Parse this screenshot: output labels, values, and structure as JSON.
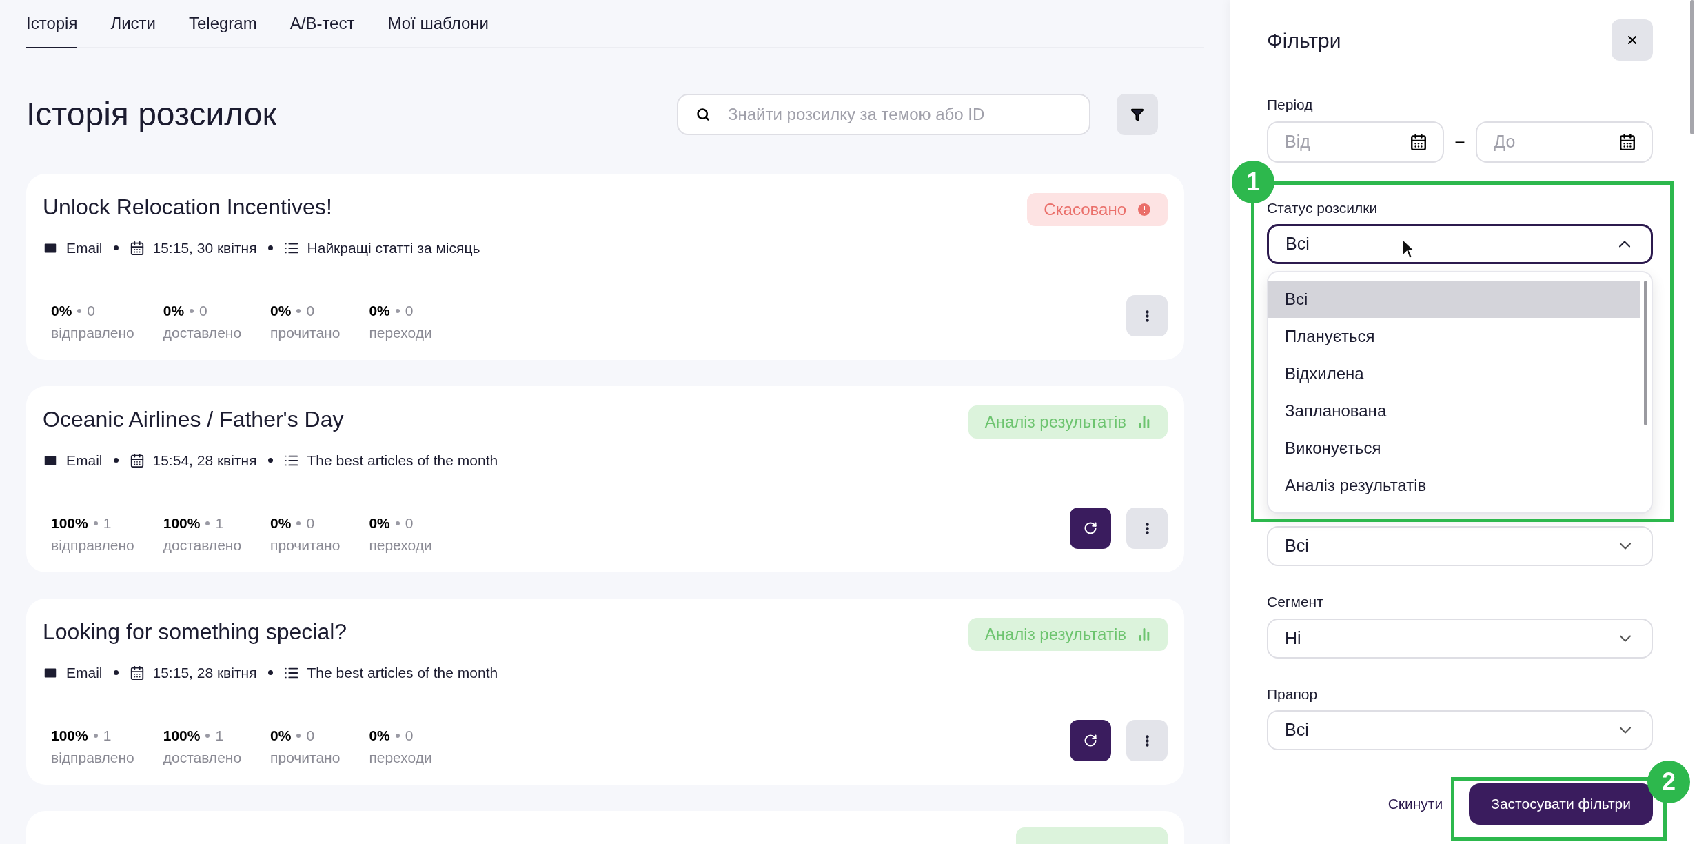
{
  "tabs": [
    {
      "label": "Історія",
      "selected": true
    },
    {
      "label": "Листи",
      "selected": false
    },
    {
      "label": "Telegram",
      "selected": false
    },
    {
      "label": "A/B-тест",
      "selected": false
    },
    {
      "label": "Мої шаблони",
      "selected": false
    }
  ],
  "page_title": "Історія розсилок",
  "search": {
    "placeholder": "Знайти розсилку за темою або ID"
  },
  "cards": [
    {
      "title": "Unlock Relocation Incentives!",
      "status": {
        "label": "Скасовано",
        "kind": "cancelled"
      },
      "channel": "Email",
      "datetime": "15:15, 30 квітня",
      "list": "Найкращі статті за місяць",
      "refresh": false,
      "stats": [
        {
          "percent": "0%",
          "count": "0",
          "label": "відправлено"
        },
        {
          "percent": "0%",
          "count": "0",
          "label": "доставлено"
        },
        {
          "percent": "0%",
          "count": "0",
          "label": "прочитано"
        },
        {
          "percent": "0%",
          "count": "0",
          "label": "переходи"
        }
      ]
    },
    {
      "title": "Oceanic Airlines / Father's Day",
      "status": {
        "label": "Аналіз результатів",
        "kind": "analysis"
      },
      "channel": "Email",
      "datetime": "15:54, 28 квітня",
      "list": "The best articles of the month",
      "refresh": true,
      "stats": [
        {
          "percent": "100%",
          "count": "1",
          "label": "відправлено"
        },
        {
          "percent": "100%",
          "count": "1",
          "label": "доставлено"
        },
        {
          "percent": "0%",
          "count": "0",
          "label": "прочитано"
        },
        {
          "percent": "0%",
          "count": "0",
          "label": "переходи"
        }
      ]
    },
    {
      "title": "Looking for something special?",
      "status": {
        "label": "Аналіз результатів",
        "kind": "analysis"
      },
      "channel": "Email",
      "datetime": "15:15, 28 квітня",
      "list": "The best articles of the month",
      "refresh": true,
      "stats": [
        {
          "percent": "100%",
          "count": "1",
          "label": "відправлено"
        },
        {
          "percent": "100%",
          "count": "1",
          "label": "доставлено"
        },
        {
          "percent": "0%",
          "count": "0",
          "label": "прочитано"
        },
        {
          "percent": "0%",
          "count": "0",
          "label": "переходи"
        }
      ]
    }
  ],
  "filters": {
    "title": "Фільтри",
    "period": {
      "label": "Період",
      "from_placeholder": "Від",
      "separator": "–",
      "to_placeholder": "До"
    },
    "status": {
      "label": "Статус розсилки",
      "value": "Всі",
      "expanded": true,
      "options": [
        {
          "label": "Всі",
          "selected": true
        },
        {
          "label": "Планується",
          "selected": false
        },
        {
          "label": "Відхилена",
          "selected": false
        },
        {
          "label": "Запланована",
          "selected": false
        },
        {
          "label": "Виконується",
          "selected": false
        },
        {
          "label": "Аналіз результатів",
          "selected": false
        }
      ]
    },
    "list": {
      "value": "Всі"
    },
    "segment": {
      "label": "Сегмент",
      "value": "Ні"
    },
    "flag": {
      "label": "Прапор",
      "value": "Всі"
    },
    "reset": "Скинути",
    "apply": "Застосувати фільтри"
  },
  "annotations": [
    {
      "number": "1"
    },
    {
      "number": "2"
    }
  ]
}
